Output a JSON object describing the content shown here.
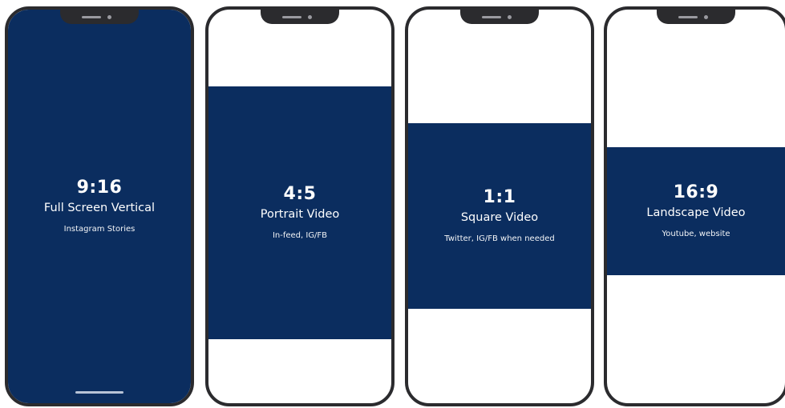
{
  "accent_color": "#0b2d5f",
  "frame_color": "#2b2b2e",
  "phones": [
    {
      "ratio": "9:16",
      "format": "Full Screen Vertical",
      "usage": "Instagram Stories",
      "has_home_indicator": true
    },
    {
      "ratio": "4:5",
      "format": "Portrait Video",
      "usage": "In-feed, IG/FB",
      "has_home_indicator": false
    },
    {
      "ratio": "1:1",
      "format": "Square Video",
      "usage": "Twitter, IG/FB when needed",
      "has_home_indicator": false
    },
    {
      "ratio": "16:9",
      "format": "Landscape Video",
      "usage": "Youtube, website",
      "has_home_indicator": false
    }
  ]
}
